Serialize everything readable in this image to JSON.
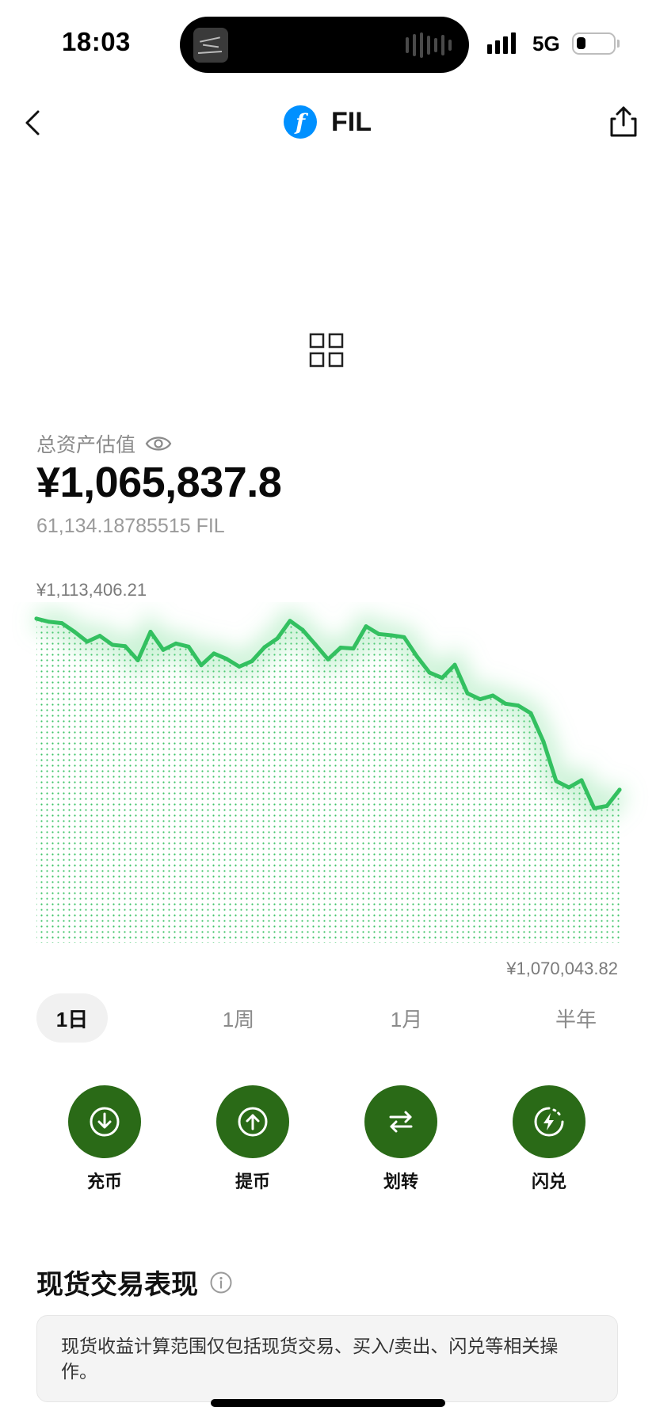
{
  "status_bar": {
    "time": "18:03",
    "network": "5G",
    "battery_level": 0.25,
    "signal_bars": 4
  },
  "nav": {
    "coin_symbol": "FIL",
    "coin_logo_glyph": "f",
    "coin_color": "#0090ff",
    "back_icon": "chevron-left-icon",
    "share_icon": "share-icon"
  },
  "assets": {
    "label": "总资产估值",
    "value": "¥1,065,837.8",
    "quantity": "61,134.18785515 FIL"
  },
  "chart_data": {
    "type": "area",
    "max_label": "¥1,113,406.21",
    "min_label": "¥1,070,043.82",
    "line_color": "#33c060",
    "ylim": [
      1065800,
      1113406.21
    ],
    "series": [
      {
        "values": [
          1112900,
          1112200,
          1111900,
          1110000,
          1107800,
          1109100,
          1107100,
          1106800,
          1103700,
          1110000,
          1106000,
          1107400,
          1106700,
          1102600,
          1105200,
          1104000,
          1102300,
          1103500,
          1106600,
          1108500,
          1112400,
          1110400,
          1107200,
          1103900,
          1106500,
          1106300,
          1111200,
          1109500,
          1109200,
          1108800,
          1104600,
          1101000,
          1099800,
          1102700,
          1096400,
          1095100,
          1095900,
          1094100,
          1093700,
          1092000,
          1085700,
          1077000,
          1075600,
          1077200,
          1071000,
          1071500,
          1075100
        ]
      }
    ]
  },
  "period_tabs": [
    {
      "label": "1日",
      "active": true
    },
    {
      "label": "1周",
      "active": false
    },
    {
      "label": "1月",
      "active": false
    },
    {
      "label": "半年",
      "active": false
    }
  ],
  "actions": [
    {
      "label": "充币",
      "icon": "deposit-icon"
    },
    {
      "label": "提币",
      "icon": "withdraw-icon"
    },
    {
      "label": "划转",
      "icon": "transfer-icon"
    },
    {
      "label": "闪兑",
      "icon": "flash-swap-icon"
    }
  ],
  "action_color": "#2a6a17",
  "spot": {
    "title": "现货交易表现",
    "notice": "现货收益计算范围仅包括现货交易、买入/卖出、闪兑等相关操作。"
  }
}
